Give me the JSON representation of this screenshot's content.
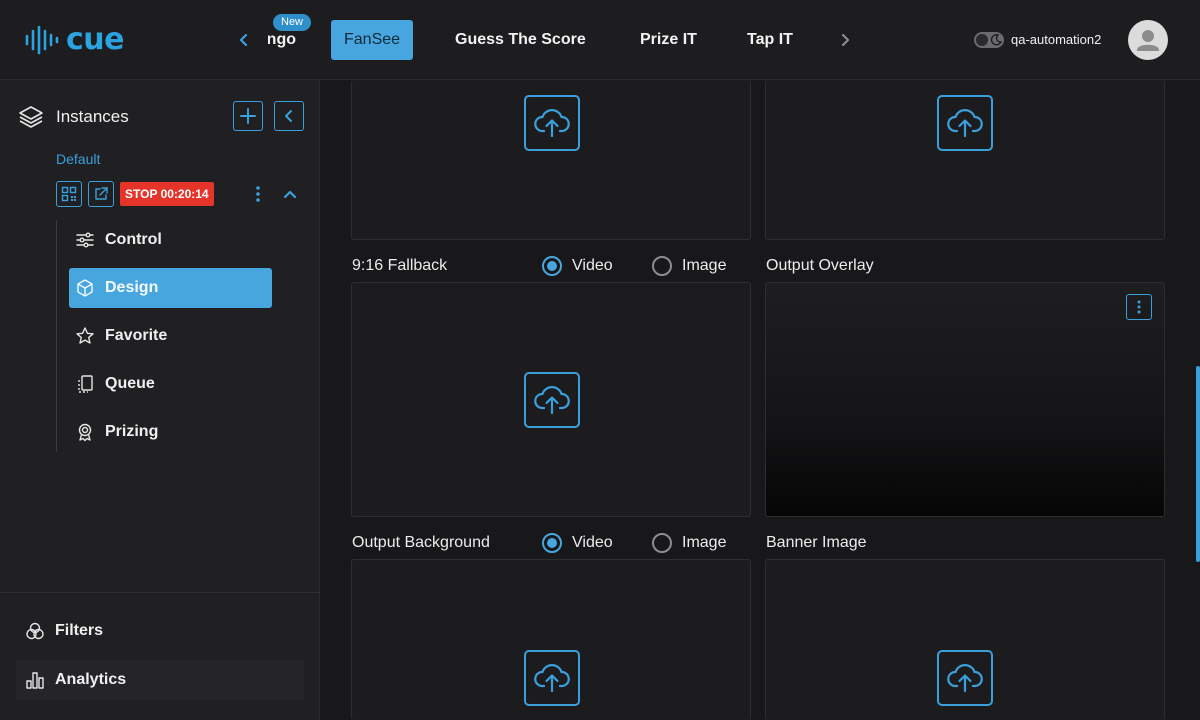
{
  "app": {
    "logo_text": "cue"
  },
  "header": {
    "tabs": [
      {
        "label": "ngo",
        "badge": "New"
      },
      {
        "label": "FanSee",
        "active": true
      },
      {
        "label": "Guess The Score"
      },
      {
        "label": "Prize IT"
      },
      {
        "label": "Tap IT"
      }
    ],
    "username": "qa-automation2"
  },
  "sidebar": {
    "title": "Instances",
    "instance": {
      "name": "Default",
      "stop_badge": "STOP 00:20:14"
    },
    "items": [
      {
        "label": "Control",
        "icon": "sliders-icon"
      },
      {
        "label": "Design",
        "icon": "cube-icon",
        "active": true
      },
      {
        "label": "Favorite",
        "icon": "star-icon"
      },
      {
        "label": "Queue",
        "icon": "queue-icon"
      },
      {
        "label": "Prizing",
        "icon": "award-icon"
      }
    ],
    "bottom": [
      {
        "label": "Filters",
        "icon": "filters-icon"
      },
      {
        "label": "Analytics",
        "icon": "analytics-icon",
        "active": true
      }
    ]
  },
  "main": {
    "fallback_label": "9:16 Fallback",
    "output_overlay_label": "Output Overlay",
    "output_background_label": "Output Background",
    "banner_image_label": "Banner Image",
    "radio_video": "Video",
    "radio_image": "Image"
  },
  "colors": {
    "accent": "#48a6de",
    "stop": "#e5342a",
    "background": "#18181b"
  }
}
